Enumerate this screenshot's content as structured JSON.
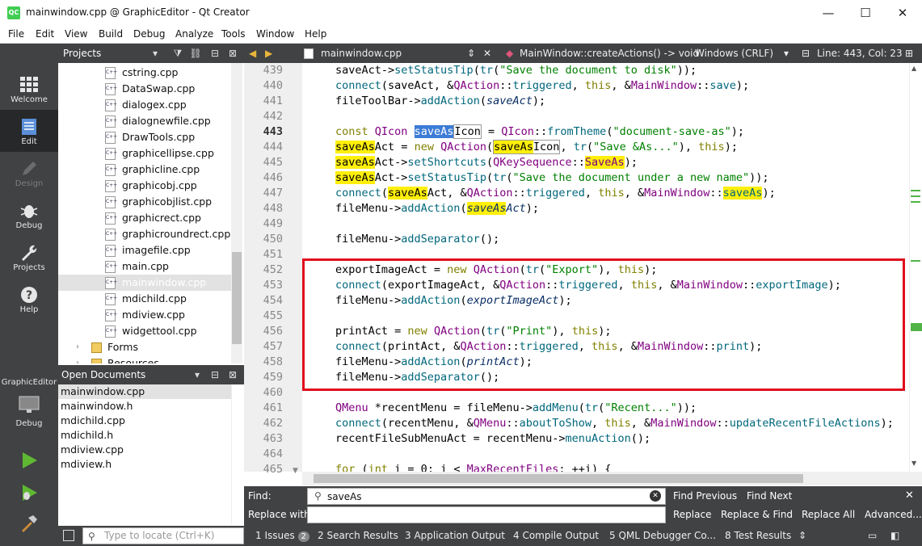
{
  "window": {
    "title": "mainwindow.cpp @ GraphicEditor - Qt Creator",
    "app_icon": "QC"
  },
  "menu": [
    "File",
    "Edit",
    "View",
    "Build",
    "Debug",
    "Analyze",
    "Tools",
    "Window",
    "Help"
  ],
  "modes": [
    {
      "label": "Welcome",
      "icon": "grid-icon"
    },
    {
      "label": "Edit",
      "icon": "document-icon",
      "active": true
    },
    {
      "label": "Design",
      "icon": "pencil-icon",
      "disabled": true
    },
    {
      "label": "Debug",
      "icon": "bug-icon"
    },
    {
      "label": "Projects",
      "icon": "wrench-icon"
    },
    {
      "label": "Help",
      "icon": "help-icon"
    }
  ],
  "kit": {
    "project": "GraphicEditor",
    "label": "Debug"
  },
  "projects_panel": {
    "title": "Projects",
    "files": [
      "cstring.cpp",
      "DataSwap.cpp",
      "dialogex.cpp",
      "dialognewfile.cpp",
      "DrawTools.cpp",
      "graphicellipse.cpp",
      "graphicline.cpp",
      "graphicobj.cpp",
      "graphicobjlist.cpp",
      "graphicrect.cpp",
      "graphicroundrect.cpp",
      "imagefile.cpp",
      "main.cpp",
      "mainwindow.cpp",
      "mdichild.cpp",
      "mdiview.cpp",
      "widgettool.cpp"
    ],
    "selected": "mainwindow.cpp",
    "folders": [
      "Forms",
      "Resources"
    ]
  },
  "open_documents": {
    "title": "Open Documents",
    "files": [
      "mainwindow.cpp",
      "mainwindow.h",
      "mdichild.cpp",
      "mdichild.h",
      "mdiview.cpp",
      "mdiview.h"
    ]
  },
  "editor": {
    "file": "mainwindow.cpp",
    "function": "MainWindow::createActions() -> void",
    "line_ending": "Windows (CRLF)",
    "position": "Line: 443, Col: 23",
    "line_numbers": [
      "439",
      "440",
      "441",
      "442",
      "443",
      "444",
      "445",
      "446",
      "447",
      "448",
      "449",
      "450",
      "451",
      "452",
      "453",
      "454",
      "455",
      "456",
      "457",
      "458",
      "459",
      "460",
      "461",
      "462",
      "463",
      "464",
      "465"
    ]
  },
  "find": {
    "find_label": "Find:",
    "replace_label": "Replace with:",
    "value": "saveAs",
    "find_previous": "Find Previous",
    "find_next": "Find Next",
    "replace": "Replace",
    "replace_find": "Replace & Find",
    "replace_all": "Replace All",
    "advanced": "Advanced..."
  },
  "status": {
    "locate_placeholder": "Type to locate (Ctrl+K)",
    "panes": [
      "1  Issues",
      "2  Search Results",
      "3  Application Output",
      "4  Compile Output",
      "5  QML Debugger Co...",
      "8  Test Results"
    ],
    "issues_count": "2"
  },
  "colors": {
    "dark_panel": "#404244",
    "highlight": "#ffef0b",
    "selection": "#3c7bd6",
    "red_box": "#e00d1c"
  }
}
